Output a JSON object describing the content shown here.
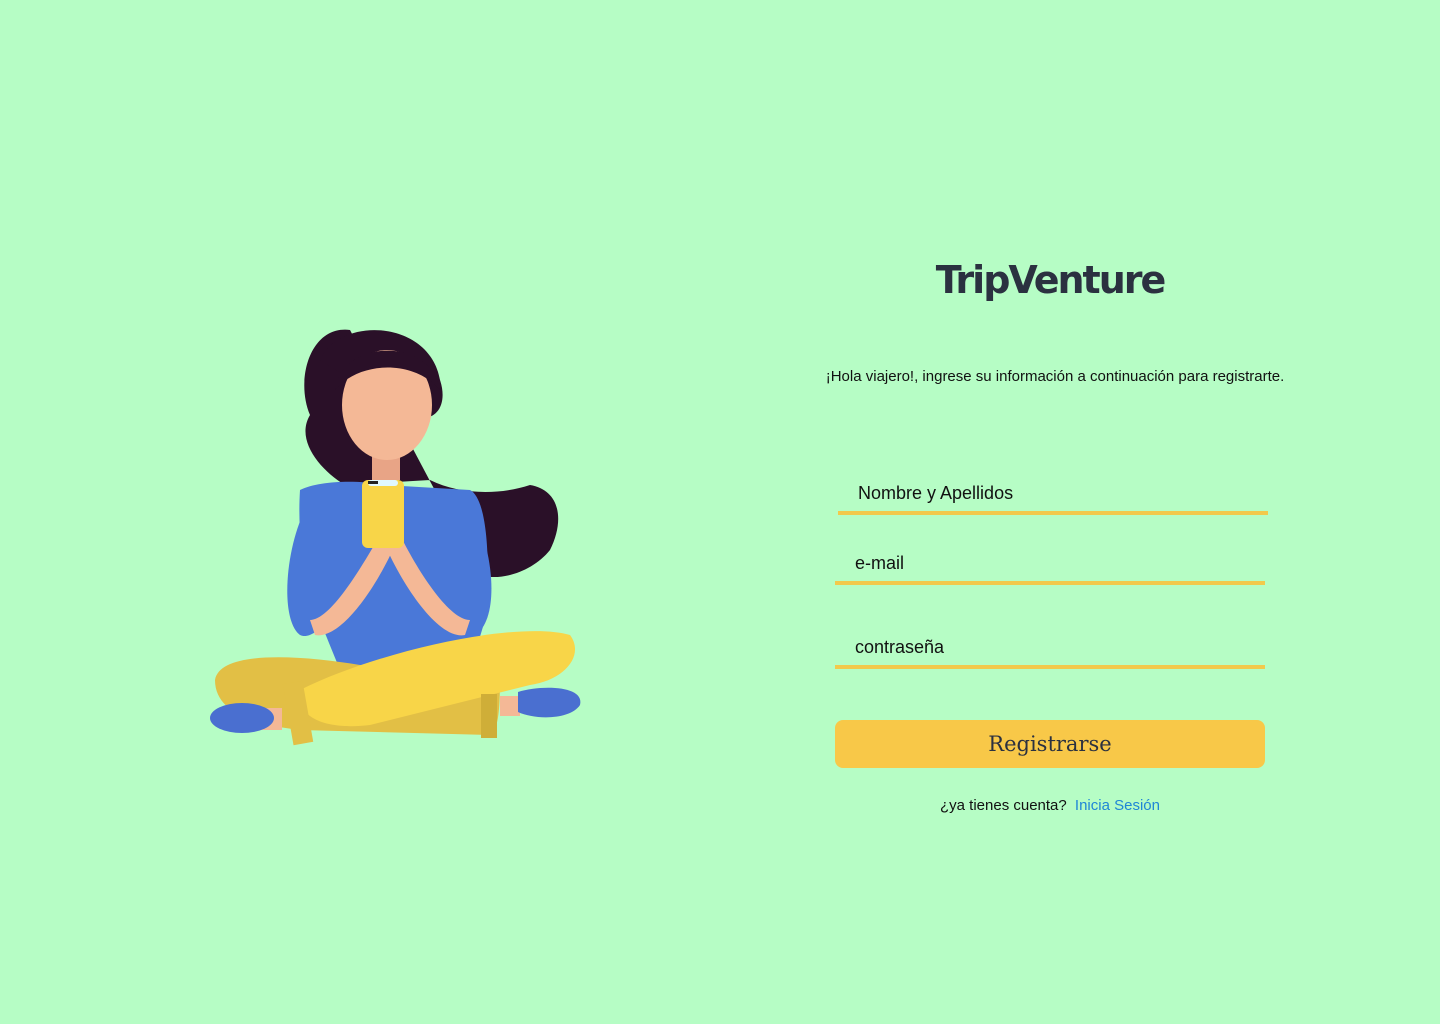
{
  "brand": {
    "title": "TripVenture"
  },
  "intro": {
    "greeting": "¡Hola viajero!,  ingrese su información a continuación para registrarte."
  },
  "form": {
    "name_placeholder": "Nombre y Apellidos",
    "email_placeholder": "e-mail",
    "password_placeholder": "contraseña",
    "submit_label": "Registrarse"
  },
  "footer": {
    "question": "¿ya tienes cuenta?",
    "login_link": "Inicia Sesión"
  },
  "colors": {
    "background": "#b6fdc5",
    "accent": "#f8c848",
    "underline": "#f2c94c",
    "link": "#1f86d6",
    "brand_text": "#2b3140"
  },
  "illustration": {
    "icon": "woman-with-phone-illustration"
  }
}
